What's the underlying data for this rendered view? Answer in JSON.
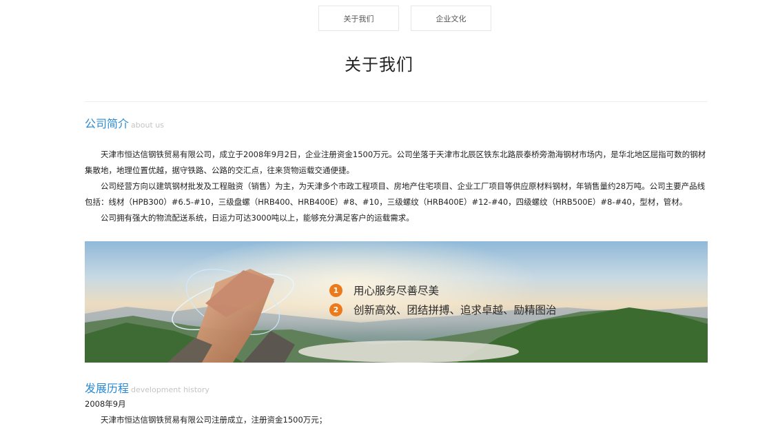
{
  "tabs": [
    {
      "label": "关于我们"
    },
    {
      "label": "企业文化"
    }
  ],
  "page_title": "关于我们",
  "about_section": {
    "title_cn": "公司简介",
    "title_en": "about us",
    "paragraphs": [
      "天津市恒达信钢铁贸易有限公司，成立于2008年9月2日，企业注册资金1500万元。公司坐落于天津市北辰区铁东北路辰泰桥旁渤海钢材市场内，是华北地区屈指可数的钢材集散地，地理位置优越，据守铁路、公路的交汇点，往来货物运载交通便捷。",
      "公司经营方向以建筑钢材批发及工程融资（销售）为主，为天津多个市政工程项目、房地产住宅项目、企业工厂项目等供应原材料钢材，年销售量约28万吨。公司主要产品线包括：线材（HPB300）#6.5-#10，三级盘螺（HRB400、HRB400E）#8、#10，三级螺纹（HRB400E）#12-#40，四级螺纹（HRB500E）#8-#40，型材，管材。",
      "公司拥有强大的物流配送系统，日运力可达3000吨以上，能够充分满足客户的运载需求。"
    ]
  },
  "banner": {
    "items": [
      {
        "num": "1",
        "text": "用心服务尽善尽美"
      },
      {
        "num": "2",
        "text": "创新高效、团结拼搏、追求卓越、励精图治"
      }
    ],
    "accent": "#ec7a1a"
  },
  "history_section": {
    "title_cn": "发展历程",
    "title_en": "development history",
    "date": "2008年9月",
    "text": "天津市恒达信钢铁贸易有限公司注册成立，注册资金1500万元；"
  },
  "colors": {
    "section_title": "#2a8ad4",
    "section_subtitle": "#c4c4c4"
  }
}
